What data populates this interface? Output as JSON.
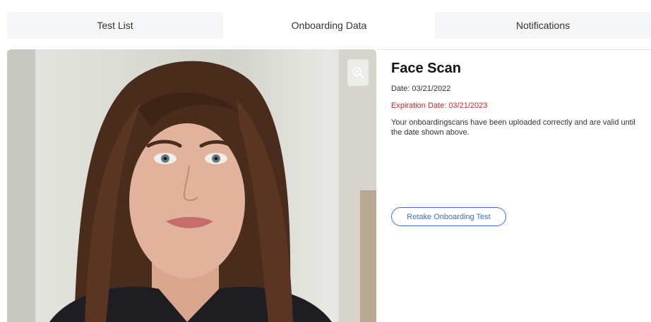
{
  "tabs": [
    {
      "label": "Test List",
      "active": false
    },
    {
      "label": "Onboarding Data",
      "active": true
    },
    {
      "label": "Notifications",
      "active": false
    }
  ],
  "photo": {
    "icon": "zoom-in-icon",
    "description_icon": "portrait-image"
  },
  "scan": {
    "title": "Face Scan",
    "date": "Date: 03/21/2022",
    "expiration": "Expiration Date: 03/21/2023",
    "description": "Your  onboardingscans have been uploaded correctly and are valid until the date shown above."
  },
  "actions": {
    "retake_label": "Retake Onboarding Test"
  },
  "colors": {
    "accent": "#3b6fd6",
    "expiration": "#c62828",
    "tab_bg": "#f5f6f8"
  }
}
